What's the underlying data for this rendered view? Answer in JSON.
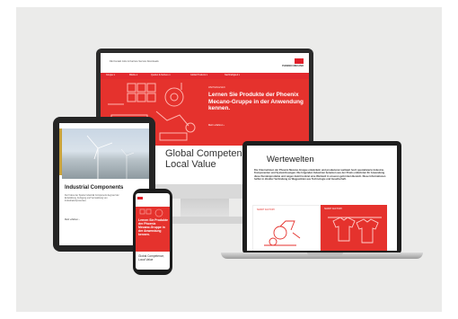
{
  "monitor": {
    "nav_items": "DE  Kontakt  Jobs & Karriere  Service  Downloads",
    "logo_text": "PHOENIX MECANO",
    "subnav_items": [
      "Gruppe ▾",
      "Märkte ▾",
      "Quellen & Karriere ▾",
      "Global Products ▾",
      "Nachhaltigkeit ▾"
    ],
    "hero_kicker": "WEITERLESEN",
    "hero_title": "Lernen Sie Produkte der Phoenix Mecano-Gruppe in der Anwendung kennen.",
    "hero_link": "Mehr erfahren ›",
    "global_line1": "Global Competen",
    "global_line2": "Local Value"
  },
  "laptop": {
    "heading": "Wertewelten",
    "body": "Die Unternehmen der Phoenix Mecano-Gruppe entwickeln und produzieren weltweit hoch spezialisierte Industrie-Komponenten und Systemlösungen. Die folgenden Industrien benutzen aus der Praxis entlehnten Ihr Anwendung diese Kundenprodukte und zeigen damit konkret eine Wertwelt in unseren geformten Bereich. Diese Informationen helfen in direkter Verbindung zu Wegpunkten aus Technologie und Gesellschaft.",
    "card_left_label": "SMART FACTORY",
    "card_right_label": "SMART FACTORY"
  },
  "tablet": {
    "title": "Industrial Components",
    "body": "Der Fokus der Sparte Industrial Components liegt auf der Entwicklung, Fertigung und Vermarktung von Industriekomponenten.",
    "link": "Mehr erfahren  ›"
  },
  "phone": {
    "title": "Lernen Sie Produkte der Phoenix Mecano-Gruppe in der Anwendung kennen.",
    "global": "Global Competence, Local Value"
  },
  "colors": {
    "brand_red": "#e5322d",
    "background": "#ebebea",
    "device_dark": "#2b2b2b"
  }
}
